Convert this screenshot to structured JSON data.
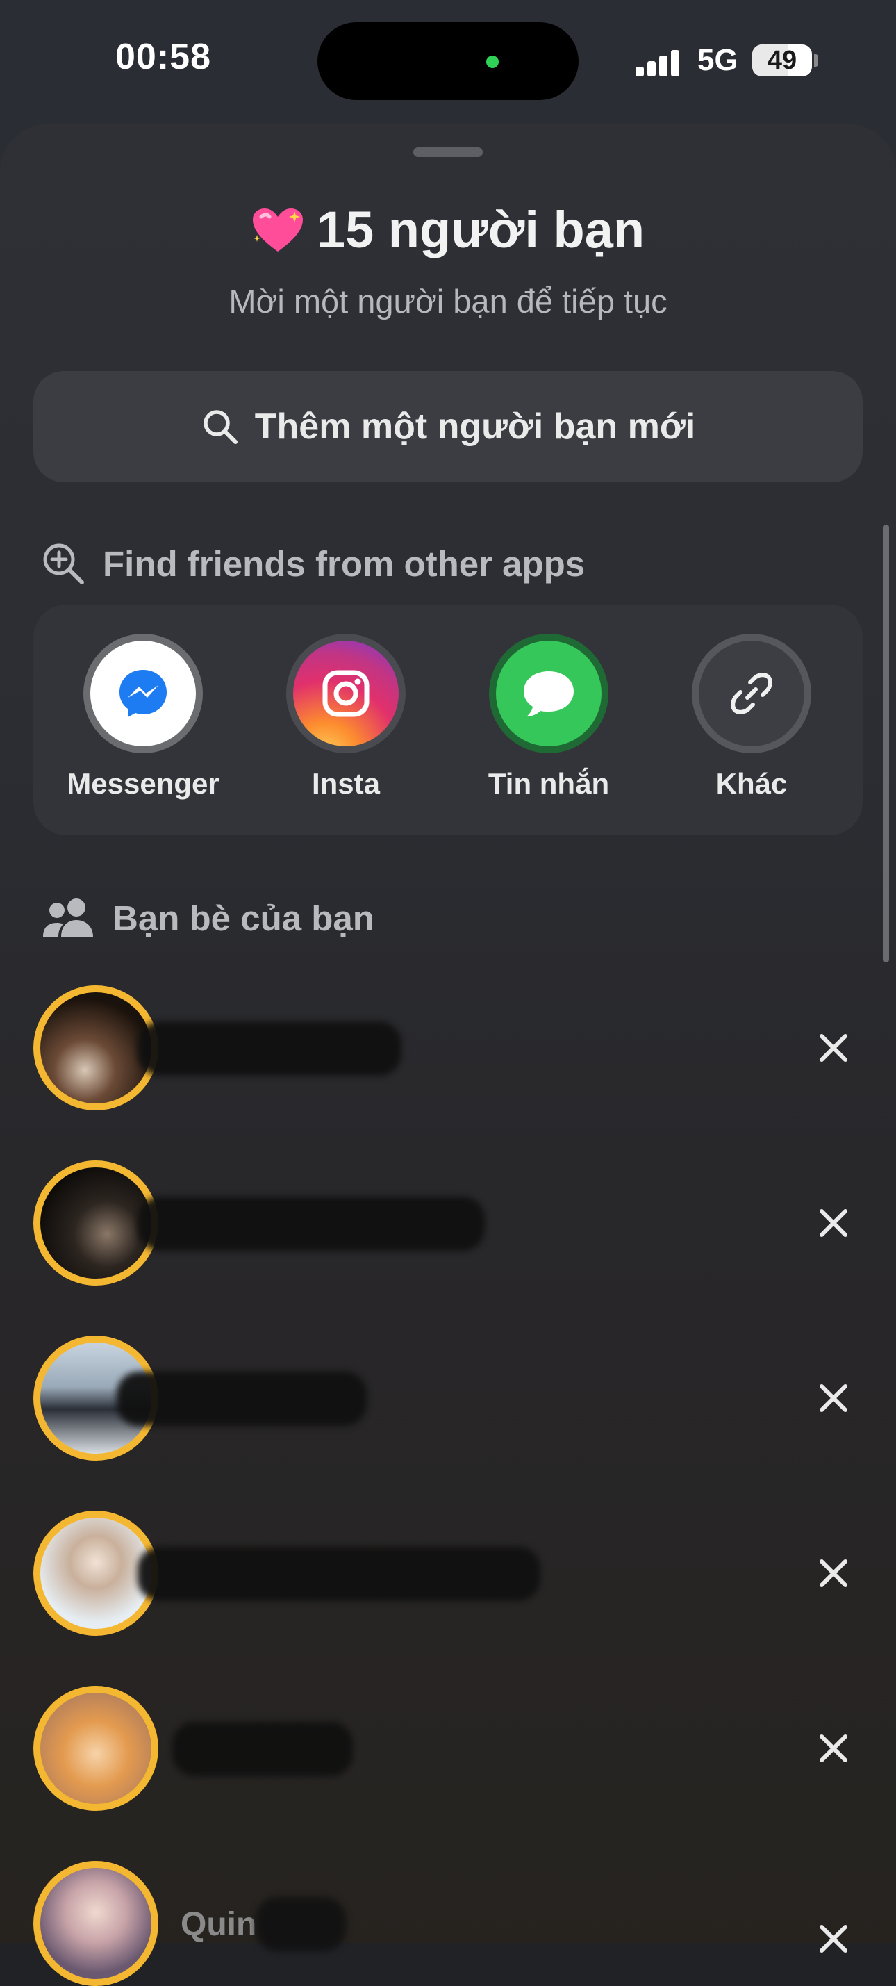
{
  "status_bar": {
    "time": "00:58",
    "network": "5G",
    "battery": "49"
  },
  "sheet": {
    "title": "15 người bạn",
    "subtitle": "Mời một người bạn để tiếp tục",
    "search_placeholder": "Thêm một người bạn mới",
    "find_friends_label": "Find friends from other apps",
    "apps": [
      {
        "label": "Messenger",
        "icon": "messenger-icon"
      },
      {
        "label": "Insta",
        "icon": "instagram-icon"
      },
      {
        "label": "Tin nhắn",
        "icon": "messages-icon"
      },
      {
        "label": "Khác",
        "icon": "link-icon"
      }
    ],
    "friends_label": "Bạn bè của bạn",
    "friends": [
      {
        "name": ""
      },
      {
        "name": ""
      },
      {
        "name": ""
      },
      {
        "name": ""
      },
      {
        "name": ""
      },
      {
        "name": "Quin"
      }
    ]
  },
  "colors": {
    "accent_ring": "#f4b731",
    "messages_green": "#35c759",
    "background": "#2a2c31"
  }
}
